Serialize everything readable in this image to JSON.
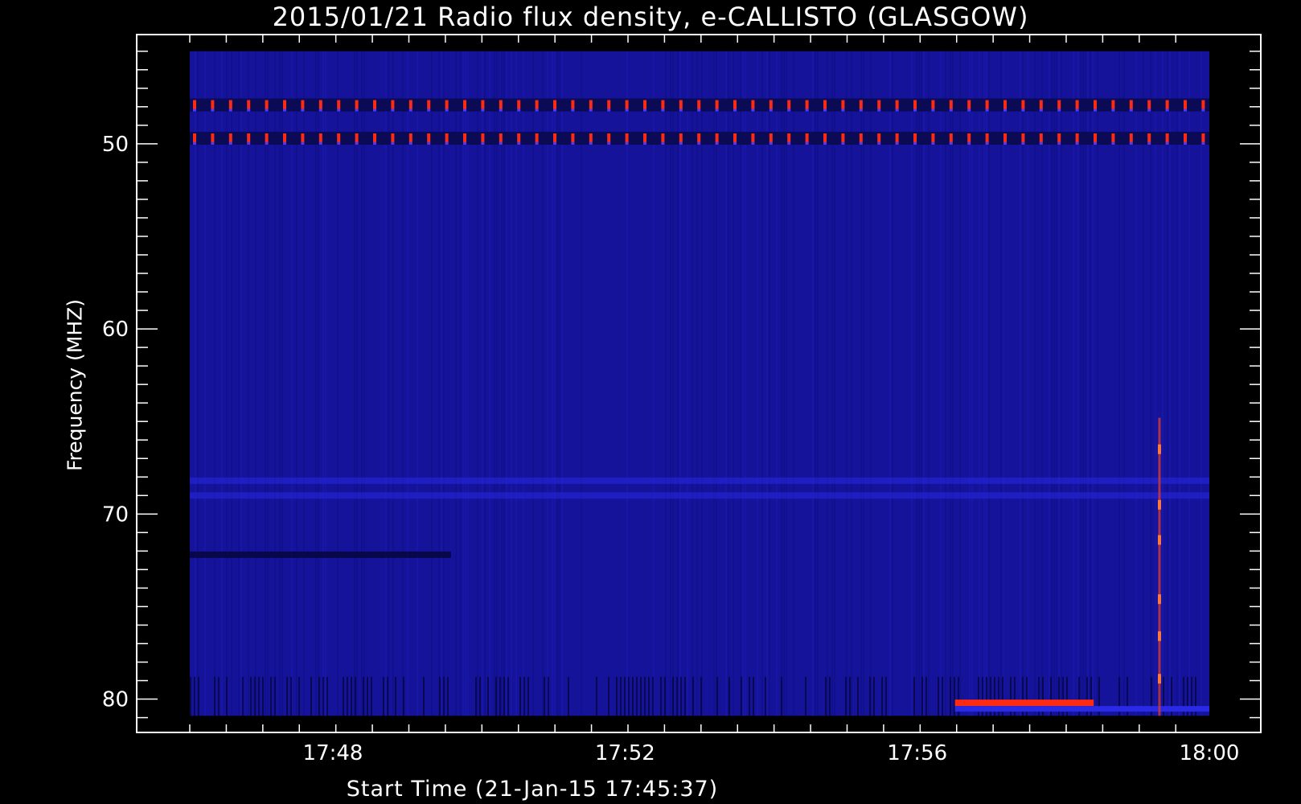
{
  "chart_data": {
    "type": "heatmap",
    "title": "2015/01/21  Radio flux density, e-CALLISTO (GLASGOW)",
    "xlabel": "Start Time (21-Jan-15 17:45:37)",
    "ylabel": "Frequency (MHZ)",
    "x_ticks": [
      "17:48",
      "17:52",
      "17:56",
      "18:00"
    ],
    "x_tick_minutes": [
      2.383,
      6.383,
      10.383,
      14.383
    ],
    "xlim_minutes": [
      0.423,
      14.383
    ],
    "y_ticks": [
      50,
      60,
      70,
      80
    ],
    "ylim": [
      44.1,
      81.8
    ],
    "y_inverted": true,
    "frequency_range_mhz": [
      45.0,
      80.9
    ],
    "grid": false,
    "colors": {
      "background": "#000000",
      "field": "#14139a",
      "emission": "#ff2a12",
      "text": "#ffffff"
    },
    "features": [
      {
        "kind": "interference_band",
        "freq_mhz": 47.9,
        "pattern": "periodic"
      },
      {
        "kind": "interference_band",
        "freq_mhz": 49.7,
        "pattern": "periodic"
      },
      {
        "kind": "weak_band",
        "freq_mhz": 68.2
      },
      {
        "kind": "weak_band",
        "freq_mhz": 69.0
      },
      {
        "kind": "dark_band",
        "freq_mhz": 72.2,
        "t_minutes": [
          0.42,
          4.0
        ]
      },
      {
        "kind": "emission_bar",
        "freq_mhz": 80.2,
        "t_minutes": [
          10.9,
          12.8
        ]
      },
      {
        "kind": "vertical_burst",
        "t_minutes": 13.7,
        "freq_mhz": [
          64.8,
          80.9
        ]
      }
    ]
  }
}
